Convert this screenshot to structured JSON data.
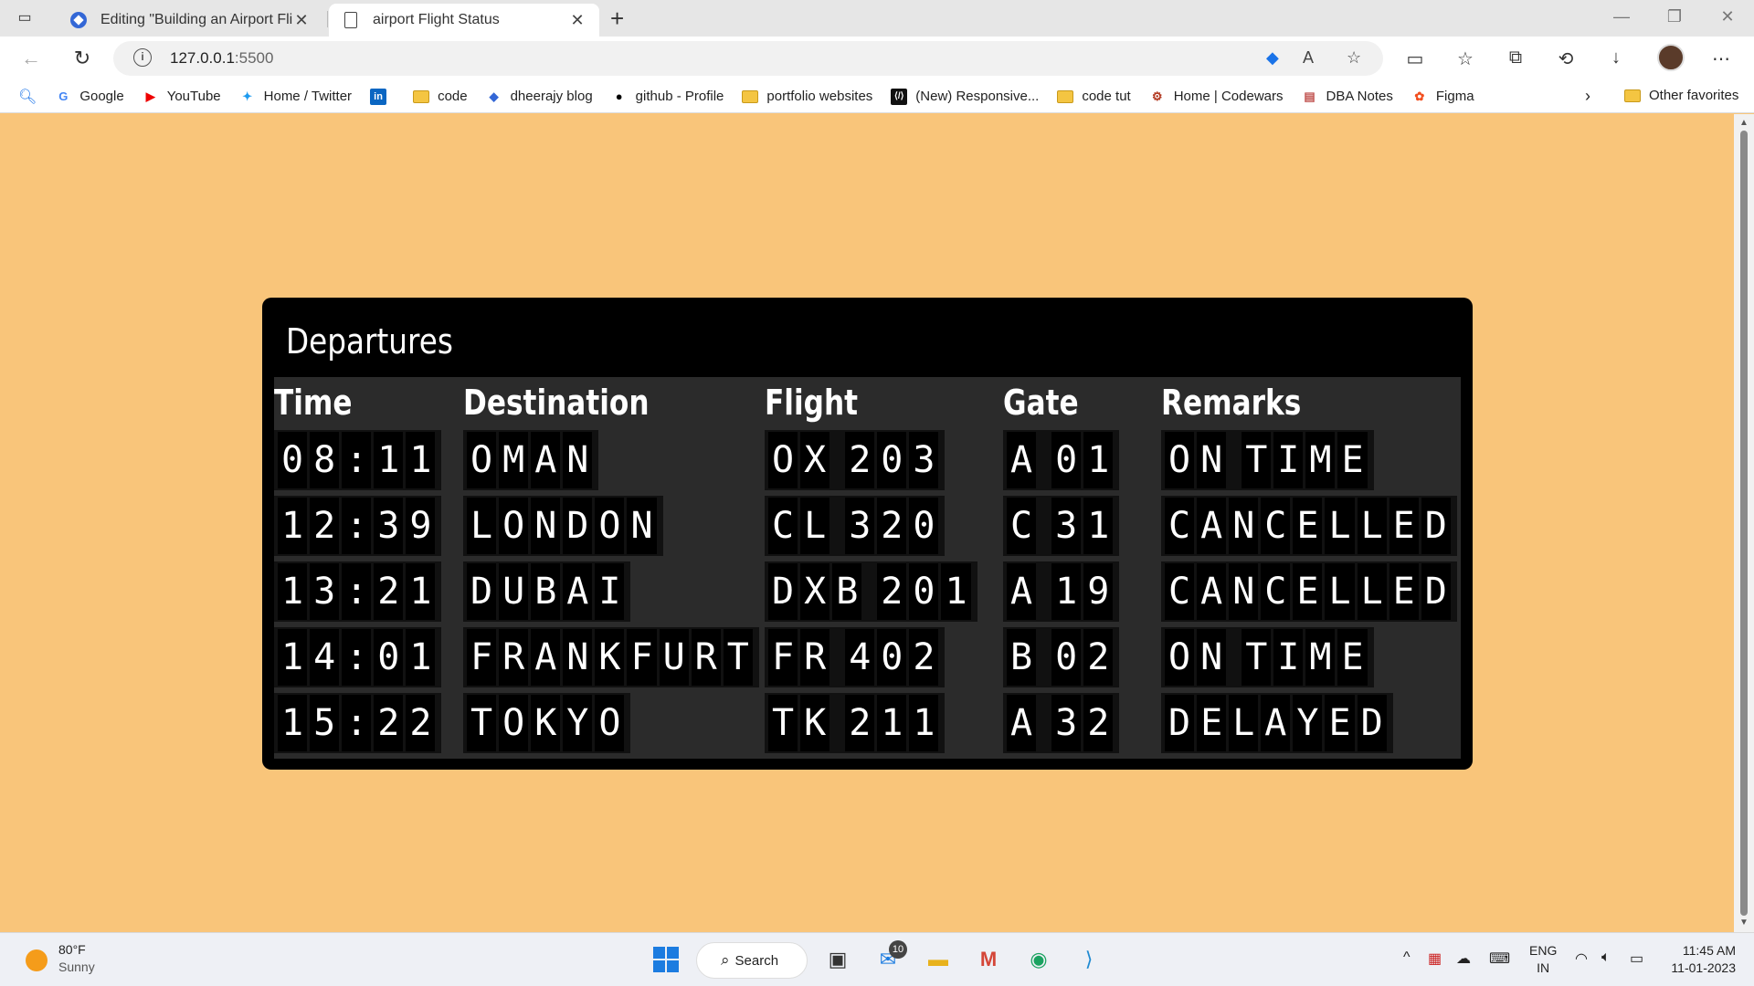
{
  "browser": {
    "tabs": [
      {
        "title": "Editing \"Building an Airport Fligh",
        "active": false
      },
      {
        "title": "airport Flight Status",
        "active": true
      }
    ],
    "url_host": "127.0.0.1",
    "url_port": ":5500",
    "bookmarks": [
      {
        "label": "Google",
        "icon": "google-icon"
      },
      {
        "label": "YouTube",
        "icon": "youtube-icon"
      },
      {
        "label": "Home / Twitter",
        "icon": "twitter-icon"
      },
      {
        "label": "",
        "icon": "linkedin-icon"
      },
      {
        "label": "code",
        "icon": "folder-icon"
      },
      {
        "label": "dheerajy blog",
        "icon": "blog-icon"
      },
      {
        "label": "github - Profile",
        "icon": "github-icon"
      },
      {
        "label": "portfolio websites",
        "icon": "folder-icon"
      },
      {
        "label": "(New) Responsive...",
        "icon": "responsive-icon"
      },
      {
        "label": "code tut",
        "icon": "folder-icon"
      },
      {
        "label": "Home | Codewars",
        "icon": "codewars-icon"
      },
      {
        "label": "DBA Notes",
        "icon": "notes-icon"
      },
      {
        "label": "Figma",
        "icon": "figma-icon"
      }
    ],
    "other_favorites": "Other favorites"
  },
  "board": {
    "title": "Departures",
    "columns": [
      "Time",
      "Destination",
      "Flight",
      "Gate",
      "Remarks"
    ],
    "rows": [
      [
        "08:11",
        "OMAN",
        "OX 203",
        "A 01",
        "ON TIME"
      ],
      [
        "12:39",
        "LONDON",
        "CL 320",
        "C 31",
        "CANCELLED"
      ],
      [
        "13:21",
        "DUBAI",
        "DXB 201",
        "A 19",
        "CANCELLED"
      ],
      [
        "14:01",
        "FRANKFURT",
        "FR 402",
        "B 02",
        "ON TIME"
      ],
      [
        "15:22",
        "TOKYO",
        "TK 211",
        "A 32",
        "DELAYED"
      ]
    ]
  },
  "taskbar": {
    "weather_temp": "80°F",
    "weather_cond": "Sunny",
    "search_label": "Search",
    "mail_badge": "10",
    "lang_top": "ENG",
    "lang_bottom": "IN",
    "time": "11:45 AM",
    "date": "11-01-2023"
  },
  "colors": {
    "page_bg": "#f9c57a",
    "board_bg": "#000000",
    "board_inner": "#2b2b2b"
  }
}
